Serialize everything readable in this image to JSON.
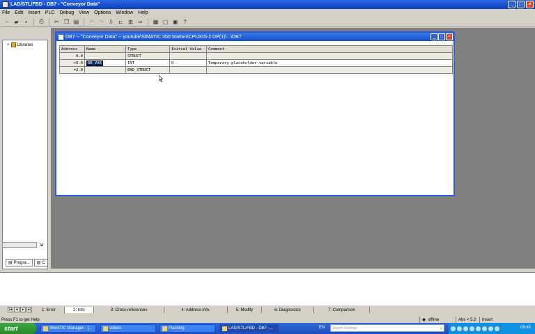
{
  "app": {
    "title": "LAD/STL/FBD - DB7 - \"Conveyor Data\""
  },
  "menu": [
    "File",
    "Edit",
    "Insert",
    "PLC",
    "Debug",
    "View",
    "Options",
    "Window",
    "Help"
  ],
  "toolbar_icons": [
    "new-icon",
    "open-icon",
    "save-icon",
    "print-icon",
    "cut-icon",
    "copy-icon",
    "paste-icon",
    "undo-icon",
    "redo-icon",
    "download-icon",
    "monitor-icon",
    "network-icon",
    "module-icon",
    "catalog-icon",
    "window-icon",
    "overview-icon",
    "whats-this-icon"
  ],
  "left_panel": {
    "tree_item": "Libraries",
    "tabs": [
      "Progra...",
      "C"
    ]
  },
  "db_window": {
    "title": "DB7 -- \"Conveyor Data\" -- youtube\\SIMATIC 300 Station\\CPU315-2 DP(1)\\...\\DB7",
    "columns": [
      "Address",
      "Name",
      "Type",
      "Initial Value",
      "Comment"
    ],
    "rows": [
      {
        "address": "0.0",
        "name": "",
        "type": "STRUCT",
        "initial": "",
        "comment": ""
      },
      {
        "address": "+0.0",
        "name": "DB_VAR",
        "type": "INT",
        "initial": "0",
        "comment": "Temporary placeholder variable"
      },
      {
        "address": "=2.0",
        "name": "",
        "type": "END_STRUCT",
        "initial": "",
        "comment": ""
      }
    ]
  },
  "output_tabs": [
    "1: Error",
    "2: Info",
    "3: Cross-references",
    "4: Address info.",
    "5: Modify",
    "6: Diagnostics",
    "7: Comparison"
  ],
  "status": {
    "help": "Press F1 to get Help.",
    "mode": "offline",
    "abs": "Abs < 5.2",
    "insert": "Insert"
  },
  "taskbar": {
    "start": "start",
    "tasks": [
      "SIMATIC Manager - [...",
      "videos",
      "Flashing",
      "LAD/STL/FBD - DB7 -..."
    ],
    "lang": "EN",
    "search_placeholder": "Search Desktop",
    "clock": "09:45"
  }
}
